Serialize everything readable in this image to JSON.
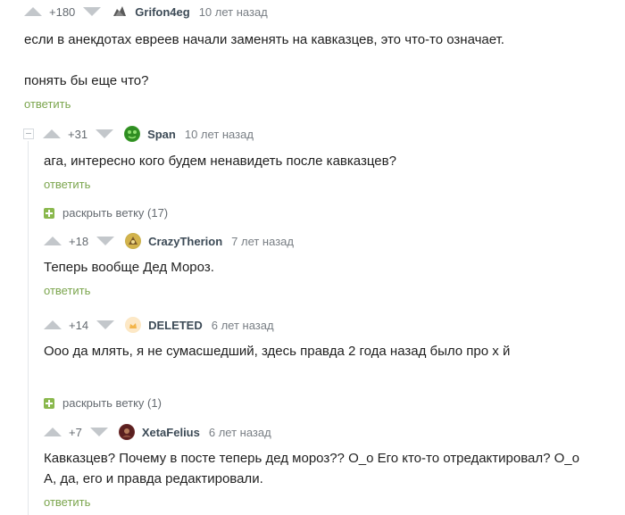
{
  "comments": [
    {
      "rating": "+180",
      "user": "Grifon4eg",
      "time": "10 лет назад",
      "lines": [
        "если в анекдотах евреев начали заменять на кавказцев, это что-то означает.",
        "понять бы еще что?"
      ],
      "reply": "ответить"
    },
    {
      "rating": "+31",
      "user": "Span",
      "time": "10 лет назад",
      "lines": [
        "ага, интересно кого будем ненавидеть после кавказцев?"
      ],
      "reply": "ответить"
    },
    {
      "rating": "+18",
      "user": "CrazyTherion",
      "time": "7 лет назад",
      "lines": [
        "Теперь вообще Дед Мороз."
      ],
      "reply": "ответить"
    },
    {
      "rating": "+14",
      "user": "DELETED",
      "time": "6 лет назад",
      "lines": [
        "Ооо да млять, я не сумасшедший, здесь правда 2 года назад было про х      й"
      ]
    },
    {
      "rating": "+7",
      "user": "XetaFelius",
      "time": "6 лет назад",
      "lines": [
        "Кавказцев? Почему в посте теперь дед мороз?? О_о Его кто-то отредактировал? О_о",
        "А, да, его и правда редактировали."
      ],
      "reply": "ответить"
    }
  ],
  "expand_branches": [
    "раскрыть ветку (17)",
    "раскрыть ветку (1)"
  ],
  "colors": {
    "reply": "#7ba54d",
    "arrow": "#c3c7cb",
    "expand_icon": "#8ab84d"
  }
}
